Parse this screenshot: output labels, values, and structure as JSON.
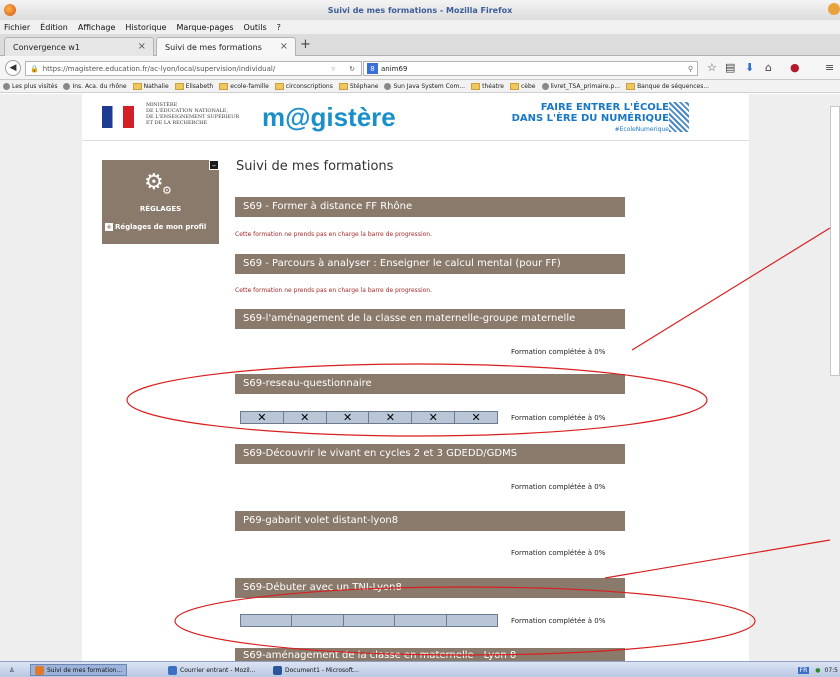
{
  "window": {
    "title": "Suivi de mes formations - Mozilla Firefox"
  },
  "menu": [
    "Fichier",
    "Édition",
    "Affichage",
    "Historique",
    "Marque-pages",
    "Outils",
    "?"
  ],
  "tabs": [
    {
      "label": "Convergence w1",
      "active": false
    },
    {
      "label": "Suivi de mes formations",
      "active": true
    }
  ],
  "nav": {
    "url": "https://magistere.education.fr/ac-lyon/local/supervision/individual/",
    "search_value": "anim69"
  },
  "bookmarks": [
    "Les plus visités",
    "Ins. Aca. du rhône",
    "Nathalie",
    "Elisabeth",
    "ecole-famille",
    "circonscriptions",
    "Stéphane",
    "Sun Java System Com...",
    "théatre",
    "cèbe",
    "livret_TSA_primaire.p...",
    "Banque de séquences..."
  ],
  "header": {
    "ministry_text": "MINISTÈRE\nDE L'ÉDUCATION NATIONALE,\nDE L'ENSEIGNEMENT SUPÉRIEUR\nET DE LA RECHERCHE",
    "logo": "m@gistère",
    "slogan_line1": "FAIRE ENTRER L'ÉCOLE",
    "slogan_line2": "DANS L'ÈRE DU NUMÉRIQUE",
    "hashtag": "#EcoleNumerique"
  },
  "sidebar": {
    "title": "RÉGLAGES",
    "link": "Réglages de mon profil",
    "collapse": "–"
  },
  "page_title": "Suivi de mes formations",
  "courses": [
    {
      "title": "S69 - Former à distance FF Rhône",
      "note": "Cette formation ne prends pas en charge la barre de progression."
    },
    {
      "title": "S69 - Parcours à analyser : Enseigner le calcul mental (pour FF)",
      "note": "Cette formation ne prends pas en charge la barre de progression."
    },
    {
      "title": "S69-l'aménagement de la classe en maternelle-groupe maternelle",
      "progress": "Formation complétée à 0%"
    },
    {
      "title": "S69-reseau-questionnaire",
      "progress": "Formation complétée à 0%",
      "cells": [
        "✕",
        "✕",
        "✕",
        "✕",
        "✕",
        "✕"
      ]
    },
    {
      "title": "S69-Découvrir le vivant en cycles 2 et 3 GDEDD/GDMS",
      "progress": "Formation complétée à 0%"
    },
    {
      "title": "P69-gabarit volet distant-lyon8",
      "progress": "Formation complétée à 0%"
    },
    {
      "title": "S69-Débuter avec un TNI-Lyon8",
      "progress": "Formation complétée à 0%",
      "cells": [
        "",
        "",
        "",
        "",
        ""
      ]
    },
    {
      "title": "S69-aménagement de la classe en maternelle - Lyon 8"
    }
  ],
  "annotation_color": "#d81f1f",
  "taskbar": {
    "buttons": [
      "Suivi de mes formation...",
      "Courrier entrant - Mozil...",
      "Document1 - Microsoft..."
    ],
    "clock": "07:5",
    "lang": "FR"
  }
}
